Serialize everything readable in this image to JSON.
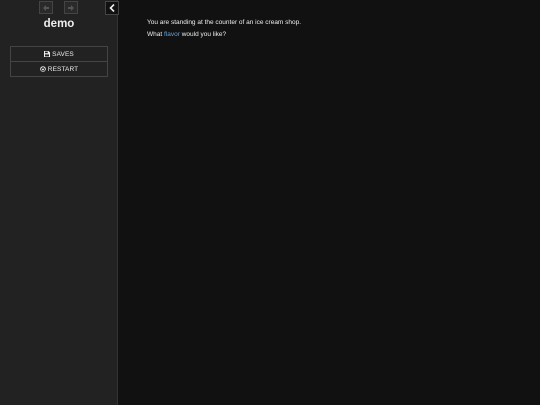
{
  "sidebar": {
    "title": "demo",
    "history": {
      "back_icon": "arrow-left-icon",
      "forward_icon": "arrow-right-icon"
    },
    "toggle_icon": "chevron-left-icon",
    "menu": [
      {
        "label": "SAVES",
        "icon": "save-icon"
      },
      {
        "label": "RESTART",
        "icon": "power-icon"
      }
    ]
  },
  "passage": {
    "line1": "You are standing at the counter of an ice cream shop.",
    "line2_before": "What",
    "line2_link": "flavor",
    "line2_after": "would you like?"
  },
  "colors": {
    "background": "#111111",
    "sidebar": "#222222",
    "text": "#eeeeee",
    "link": "#68a0d8"
  }
}
